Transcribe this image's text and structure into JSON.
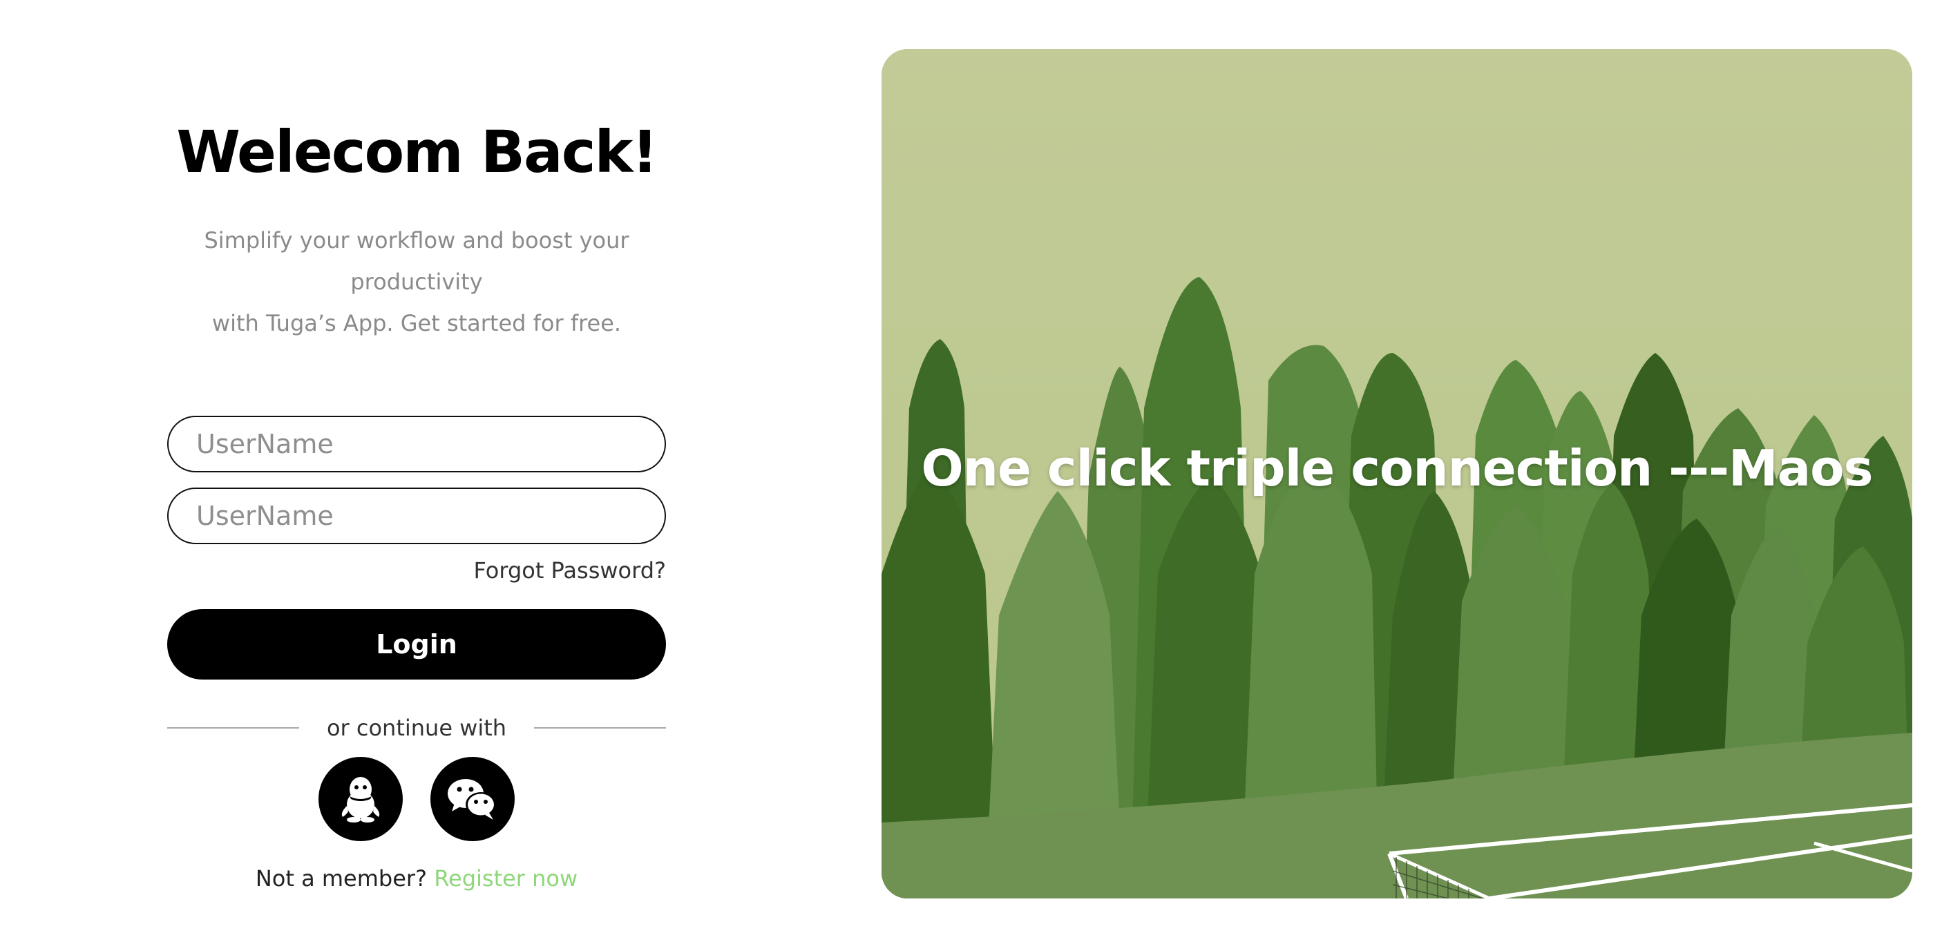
{
  "login": {
    "title": "Welecom Back!",
    "subtitle_line1": "Simplify your workflow and boost your productivity",
    "subtitle_line2": "with Tuga’s App. Get started for free.",
    "username_placeholder": "UserName",
    "password_placeholder": "UserName",
    "forgot_password": "Forgot Password?",
    "login_button": "Login",
    "divider_text": "or continue with",
    "social": [
      {
        "icon": "qq-penguin-icon"
      },
      {
        "icon": "wechat-icon"
      }
    ],
    "register_prompt": "Not a member?",
    "register_link": "Register now"
  },
  "hero": {
    "tagline": "One click triple connection ---Maos"
  },
  "colors": {
    "accent_green": "#8fd67a",
    "button_black": "#000000",
    "hero_bg": "#c3cc98"
  }
}
